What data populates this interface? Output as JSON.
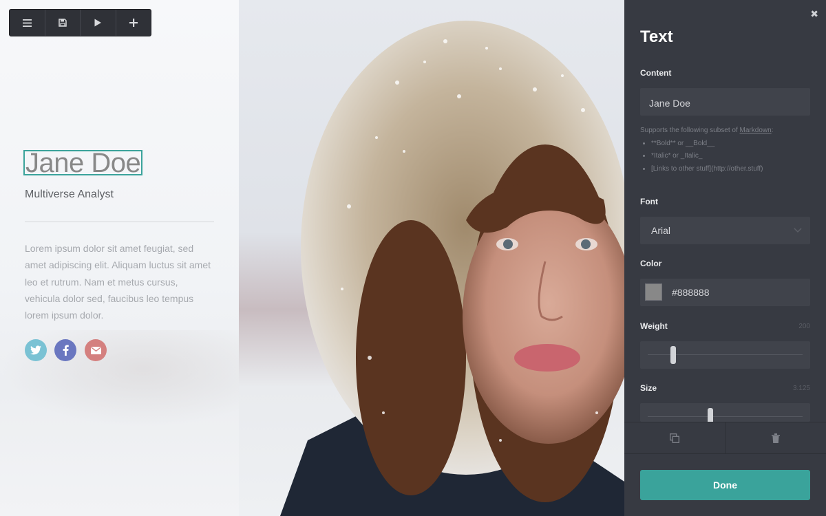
{
  "toolbar": {
    "buttons": [
      {
        "name": "menu",
        "icon": "menu-icon"
      },
      {
        "name": "save",
        "icon": "save-icon"
      },
      {
        "name": "preview",
        "icon": "play-icon"
      },
      {
        "name": "add",
        "icon": "plus-icon"
      }
    ]
  },
  "profile": {
    "name": "Jane Doe",
    "title": "Multiverse Analyst",
    "bio": "Lorem ipsum dolor sit amet feugiat, sed amet adipiscing elit. Aliquam luctus sit amet leo et rutrum. Nam et metus cursus, vehicula dolor sed, faucibus leo tempus lorem ipsum dolor.",
    "name_color": "#888888",
    "social": [
      {
        "icon": "twitter-icon",
        "color": "#7ac2d4"
      },
      {
        "icon": "facebook-icon",
        "color": "#6a77c0"
      },
      {
        "icon": "email-icon",
        "color": "#d4807f"
      }
    ]
  },
  "panel": {
    "title": "Text",
    "content_label": "Content",
    "content_value": "Jane Doe",
    "help_intro": "Supports the following subset of ",
    "help_link": "Markdown",
    "help_colon": ":",
    "help_items": [
      "**Bold** or __Bold__",
      "*Italic* or _Italic_",
      "[Links to other stuff](http://other.stuff)"
    ],
    "font_label": "Font",
    "font_value": "Arial",
    "color_label": "Color",
    "color_value": "#888888",
    "weight_label": "Weight",
    "weight_value": "200",
    "weight_level": 0.15,
    "size_label": "Size",
    "size_value": "3.125",
    "size_level": 0.4,
    "done_label": "Done"
  },
  "colors": {
    "accent": "#3aa39b",
    "panel_bg": "#373a42"
  }
}
